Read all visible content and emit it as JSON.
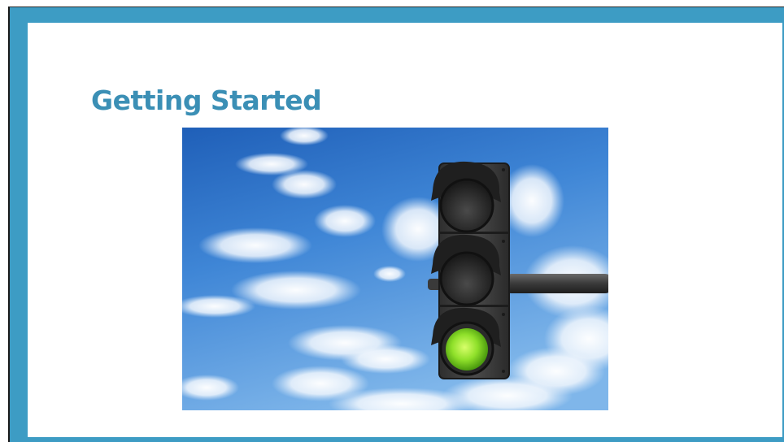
{
  "slide": {
    "title": "Getting Started",
    "frame_color": "#3d9cc4",
    "title_color": "#3b8fb5"
  },
  "image": {
    "subject": "traffic-light",
    "active_signal": "green",
    "background": "sky-with-clouds"
  }
}
